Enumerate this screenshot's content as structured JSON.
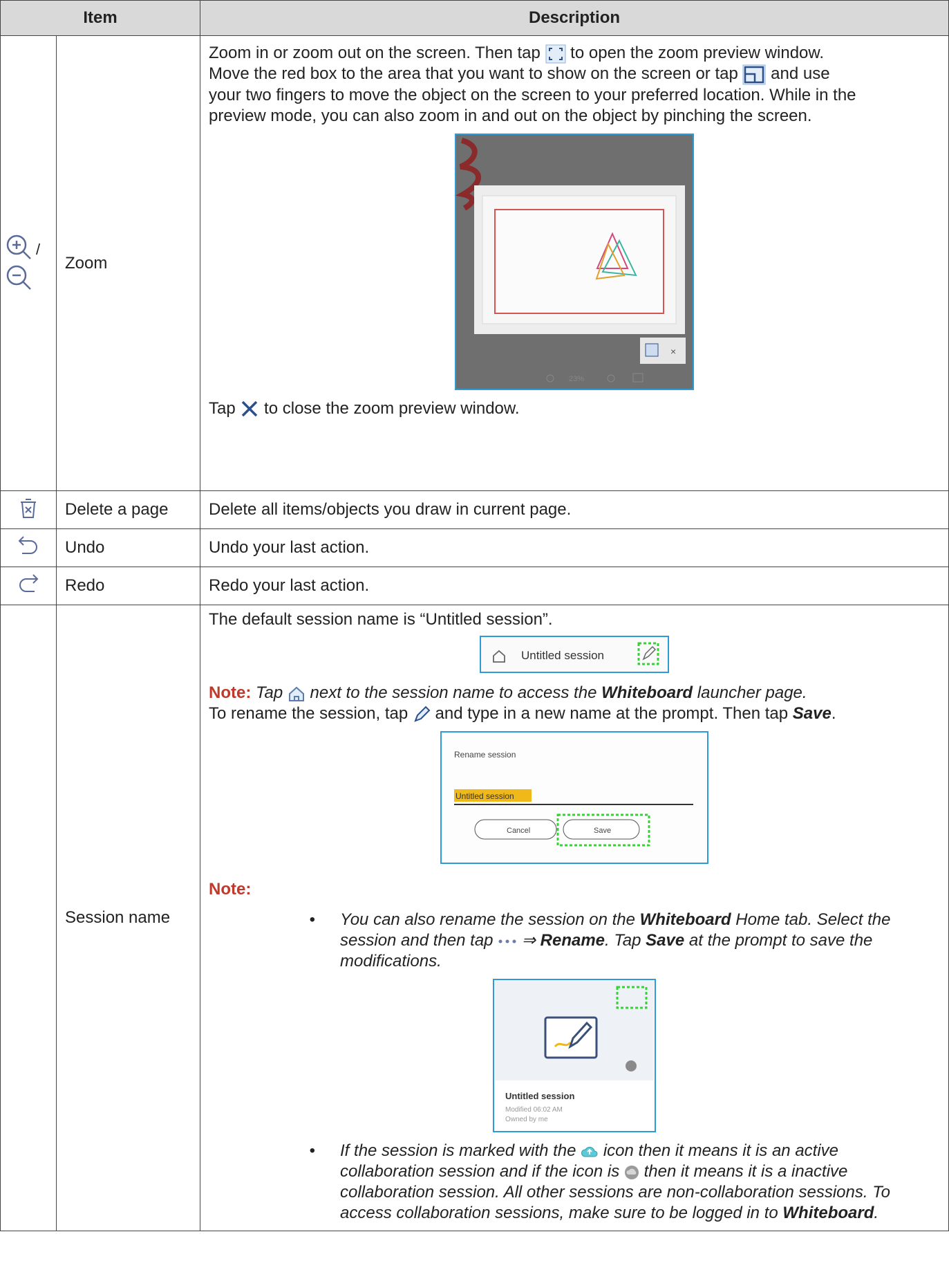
{
  "header": {
    "item": "Item",
    "description": "Description"
  },
  "rows": [
    {
      "icon": "zoom-in-out-icon",
      "icon_sep": "/",
      "name": "Zoom",
      "desc_p1_a": "Zoom in or zoom out on the screen. Then tap ",
      "desc_p1_b": " to open the zoom preview window.",
      "desc_p2_a": "Move the red box to the area that you want to show on the screen or tap ",
      "desc_p2_b": " and use",
      "desc_p3": "your two fingers to move the object on the screen to your preferred location. While in the",
      "desc_p4": "preview mode, you can also zoom in and out on the object by pinching the screen.",
      "preview_zoom_text": "23%",
      "close_a": "Tap ",
      "close_b": " to close the zoom preview window."
    },
    {
      "icon": "delete-page-icon",
      "name": "Delete a page",
      "desc": "Delete all items/objects you draw in current page."
    },
    {
      "icon": "undo-icon",
      "name": "Undo",
      "desc": "Undo your last action."
    },
    {
      "icon": "redo-icon",
      "name": "Redo",
      "desc": "Redo your last action."
    },
    {
      "name": "Session name",
      "default_text": "The default session name is “Untitled session”.",
      "bar_session_name": "Untitled session",
      "note_label": "Note:",
      "note1_a": "Tap ",
      "note1_b": " next to the session name to access the ",
      "note1_app": "Whiteboard",
      "note1_c": " launcher page.",
      "rename_a": "To rename the session, tap ",
      "rename_b": " and type in a new name at the prompt. Then tap ",
      "rename_save": "Save",
      "rename_dot": ".",
      "dialog": {
        "title": "Rename session",
        "value": "Untitled session",
        "cancel": "Cancel",
        "save": "Save"
      },
      "note2_label": "Note:",
      "bullet_symbol": "•",
      "b1_a": "You can also rename the session on the ",
      "b1_app": "Whiteboard",
      "b1_b": " Home tab. Select the session and then tap ",
      "b1_arrow": " ⇒ ",
      "b1_rename": "Rename",
      "b1_c": ". Tap ",
      "b1_save": "Save",
      "b1_d": " at the prompt to save the modifications.",
      "card": {
        "title": "Untitled session",
        "modified": "Modified 06:02 AM",
        "owner": "Owned by me"
      },
      "b2_a": "If the session is marked with the ",
      "b2_b": " icon then it means it is an active collaboration session and if the icon is ",
      "b2_c": " then it means it is a inactive collaboration session. All other sessions are non-collaboration sessions. To access collaboration sessions, make sure to be logged in to ",
      "b2_app": "Whiteboard",
      "b2_d": "."
    }
  ]
}
